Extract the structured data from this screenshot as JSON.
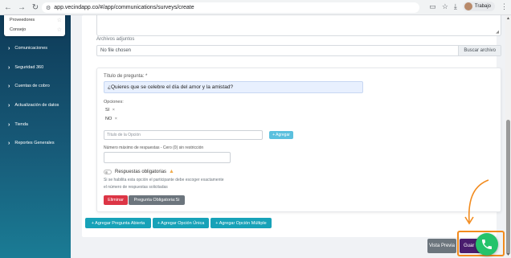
{
  "browser": {
    "url": "app.vecindapp.co/#/app/communications/surveys/create",
    "profile_name": "Trabajo"
  },
  "sidebar": {
    "dropdown_items": [
      {
        "label": "Proveedores"
      },
      {
        "label": "Consejo"
      }
    ],
    "items": [
      {
        "label": "Comunicaciones"
      },
      {
        "label": "Seguridad 360"
      },
      {
        "label": "Cuentas de cobro"
      },
      {
        "label": "Actualización de datos"
      },
      {
        "label": "Tienda"
      },
      {
        "label": "Reportes Generales"
      }
    ]
  },
  "form": {
    "attachments_label": "Archivos adjuntos",
    "file_placeholder": "No file chosen",
    "file_button": "Buscar archivo",
    "question": {
      "title_label": "Título de pregunta: *",
      "title_value": "¿Quieres que se celebre el día del amor y la amistad?",
      "options_label": "Opciones:",
      "options": [
        {
          "label": "SI",
          "remove": "×"
        },
        {
          "label": "NO",
          "remove": "×"
        }
      ],
      "option_placeholder": "Título de la Opción",
      "add_option_button": "+ Agregar",
      "max_label": "Número máximo de respuestas - Cero (0) sin restricción",
      "max_value": "",
      "required_toggle_label": "Respuestas obligatorias",
      "required_help_1": "Si se habilita esta opción el participante debe escoger exactamente",
      "required_help_2": "el número de respuestas solicitadas",
      "delete_button": "Eliminar",
      "required_button": "Pregunta Obligatoria:Si"
    },
    "add_buttons": [
      {
        "label": "+ Agregar Pregunta Abierta"
      },
      {
        "label": "+ Agregar Opción Única"
      },
      {
        "label": "+ Agregar Opción Múltiple"
      }
    ],
    "preview_button": "Vista Previa",
    "save_button": "Guar"
  },
  "colors": {
    "highlight": "#f28b1e",
    "whatsapp": "#25c36b",
    "add_buttons": "#17a2b8",
    "save": "#4a1d6e"
  }
}
